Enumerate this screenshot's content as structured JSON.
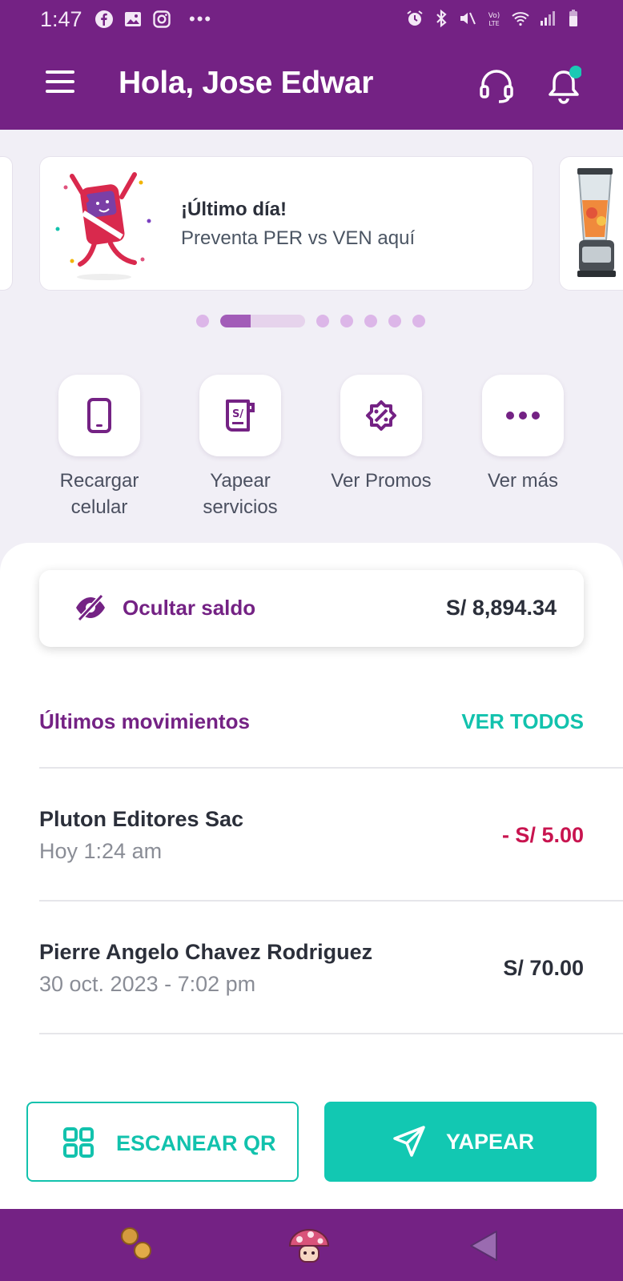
{
  "status_bar": {
    "time": "1:47",
    "left_icons": [
      "facebook-icon",
      "gallery-icon",
      "instagram-icon",
      "more-dots-icon"
    ],
    "right_icons": [
      "alarm-icon",
      "bluetooth-icon",
      "mute-icon",
      "volte-icon",
      "wifi-icon",
      "signal-icon",
      "battery-icon"
    ]
  },
  "header": {
    "greeting": "Hola, Jose Edwar",
    "icons": [
      "menu-icon",
      "headset-icon",
      "bell-icon"
    ],
    "notification_dot_color": "#1bc9b4"
  },
  "carousel": {
    "banner_title": "¡Último día!",
    "banner_subtitle": "Preventa PER vs VEN aquí",
    "dot_count": 7,
    "active_index": 1,
    "active_progress": 0.36
  },
  "quick_actions": [
    {
      "label_line1": "Recargar",
      "label_line2": "celular",
      "icon": "phone-icon"
    },
    {
      "label_line1": "Yapear",
      "label_line2": "servicios",
      "icon": "receipt-icon"
    },
    {
      "label_line1": "Ver Promos",
      "label_line2": "",
      "icon": "promo-icon"
    },
    {
      "label_line1": "Ver más",
      "label_line2": "",
      "icon": "more-icon"
    }
  ],
  "balance": {
    "hide_label": "Ocultar saldo",
    "amount": "S/ 8,894.34"
  },
  "movements": {
    "title": "Últimos movimientos",
    "see_all": "VER TODOS",
    "items": [
      {
        "name": "Pluton Editores Sac",
        "date": "Hoy 1:24 am",
        "amount": "- S/ 5.00",
        "type": "debit"
      },
      {
        "name": "Pierre Angelo Chavez Rodriguez",
        "date": "30 oct. 2023 - 7:02 pm",
        "amount": "S/ 70.00",
        "type": "credit"
      }
    ]
  },
  "actions": {
    "scan_qr": "ESCANEAR QR",
    "yapear": "YAPEAR"
  },
  "colors": {
    "brand_purple": "#742284",
    "accent_teal": "#12c2ad",
    "debit_red": "#c8144f"
  }
}
